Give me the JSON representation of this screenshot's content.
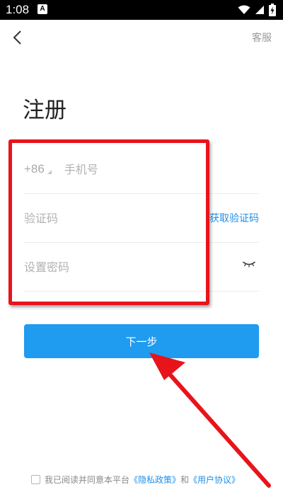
{
  "status_bar": {
    "time": "1:08",
    "notification_glyph": "A",
    "icons": [
      "wifi-icon",
      "signal-icon",
      "battery-charging-icon"
    ]
  },
  "header": {
    "back_icon": "chevron-left-icon",
    "service_label": "客服"
  },
  "page": {
    "title": "注册"
  },
  "form": {
    "country_code": "+86",
    "phone_placeholder": "手机号",
    "code_placeholder": "验证码",
    "get_code_label": "获取验证码",
    "password_placeholder": "设置密码",
    "password_toggle_icon": "eye-closed-icon"
  },
  "actions": {
    "next_label": "下一步"
  },
  "agreement": {
    "prefix": "我已阅读并同意本平台",
    "privacy_link": "《隐私政策》",
    "conjunction": "和",
    "terms_link": "《用户协议》"
  },
  "colors": {
    "accent": "#1f9bf0",
    "link": "#1f8fe6",
    "annotation_red": "#e8141b"
  }
}
